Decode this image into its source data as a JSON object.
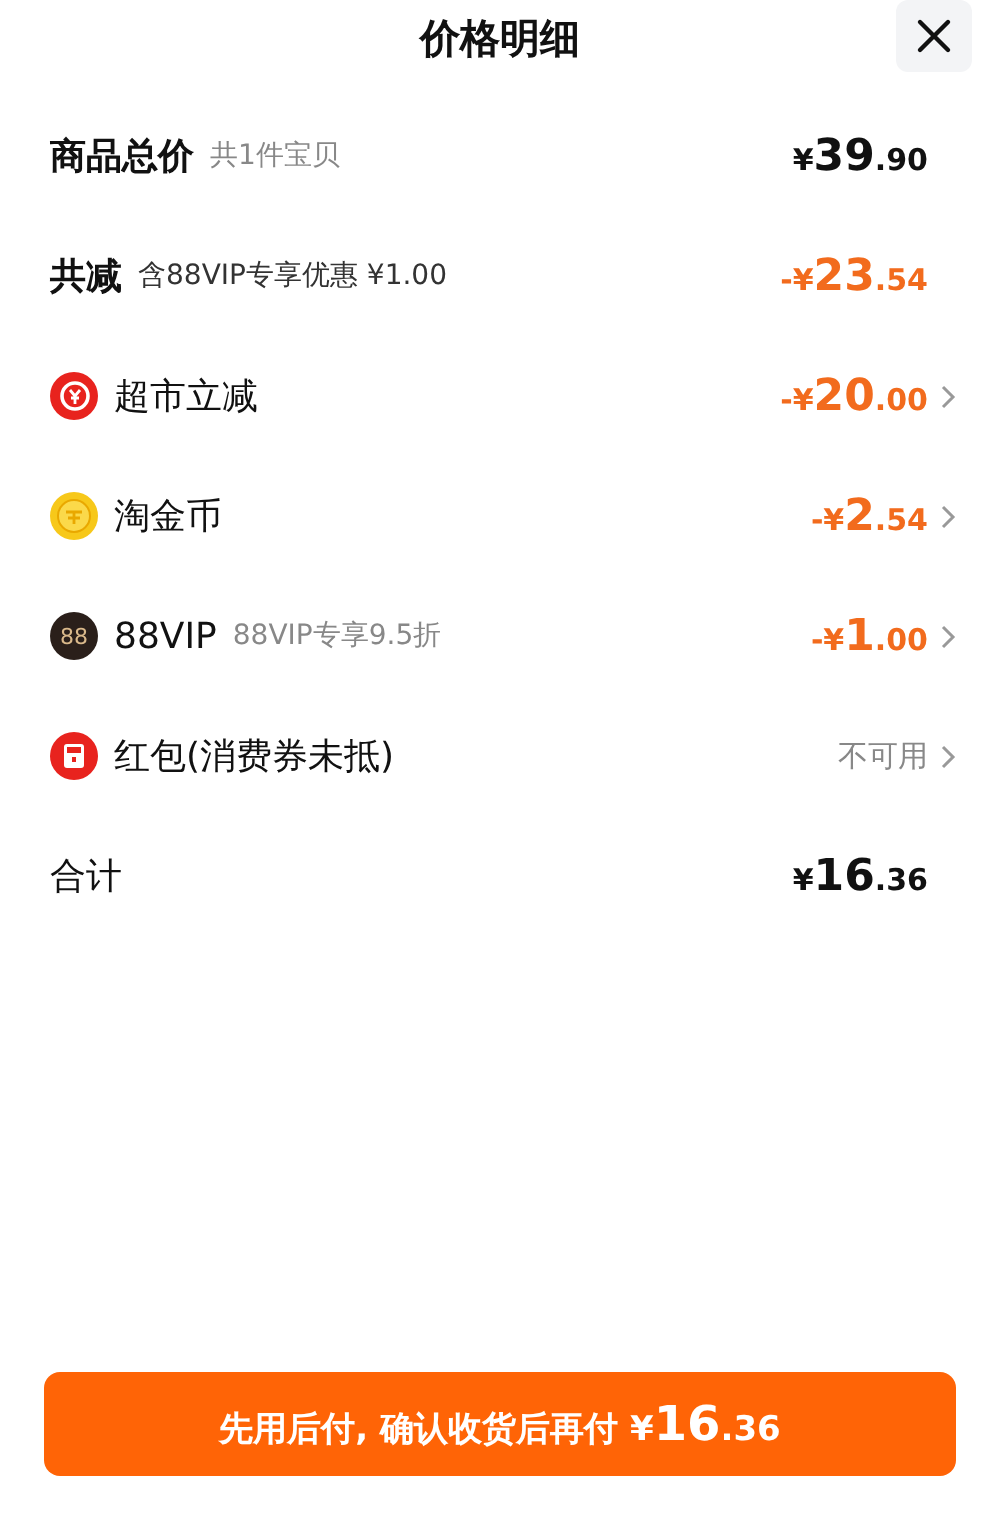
{
  "header": {
    "title": "价格明细"
  },
  "rows": [
    {
      "kind": "summary",
      "label": "商品总价",
      "note": "共1件宝贝",
      "price": {
        "discount": false,
        "prefix": "¥",
        "main": "39",
        "decimal": ".90"
      },
      "chevron": false
    },
    {
      "kind": "summary",
      "label": "共减",
      "note": "含88VIP专享优惠 ¥1.00",
      "price": {
        "discount": true,
        "prefix": "-¥",
        "main": "23",
        "decimal": ".54"
      },
      "chevron": false
    },
    {
      "kind": "coupon",
      "label": "超市立减",
      "price": {
        "discount": true,
        "prefix": "-¥",
        "main": "20",
        "decimal": ".00"
      },
      "chevron": true
    },
    {
      "kind": "coin",
      "label": "淘金币",
      "price": {
        "discount": true,
        "prefix": "-¥",
        "main": "2",
        "decimal": ".54"
      },
      "chevron": true
    },
    {
      "kind": "vip",
      "icon_text": "88",
      "label": "88VIP",
      "note": "88VIP专享9.5折",
      "price": {
        "discount": true,
        "prefix": "-¥",
        "main": "1",
        "decimal": ".00"
      },
      "chevron": true
    },
    {
      "kind": "envelope",
      "label": "红包(消费券未抵)",
      "status": "不可用",
      "chevron": true
    },
    {
      "kind": "total",
      "label": "合计",
      "price": {
        "discount": false,
        "prefix": "¥",
        "main": "16",
        "decimal": ".36"
      },
      "chevron": false
    }
  ],
  "pay_button": {
    "label": "先用后付, 确认收货后再付",
    "price": {
      "prefix": "¥",
      "main": "16",
      "decimal": ".36"
    }
  }
}
